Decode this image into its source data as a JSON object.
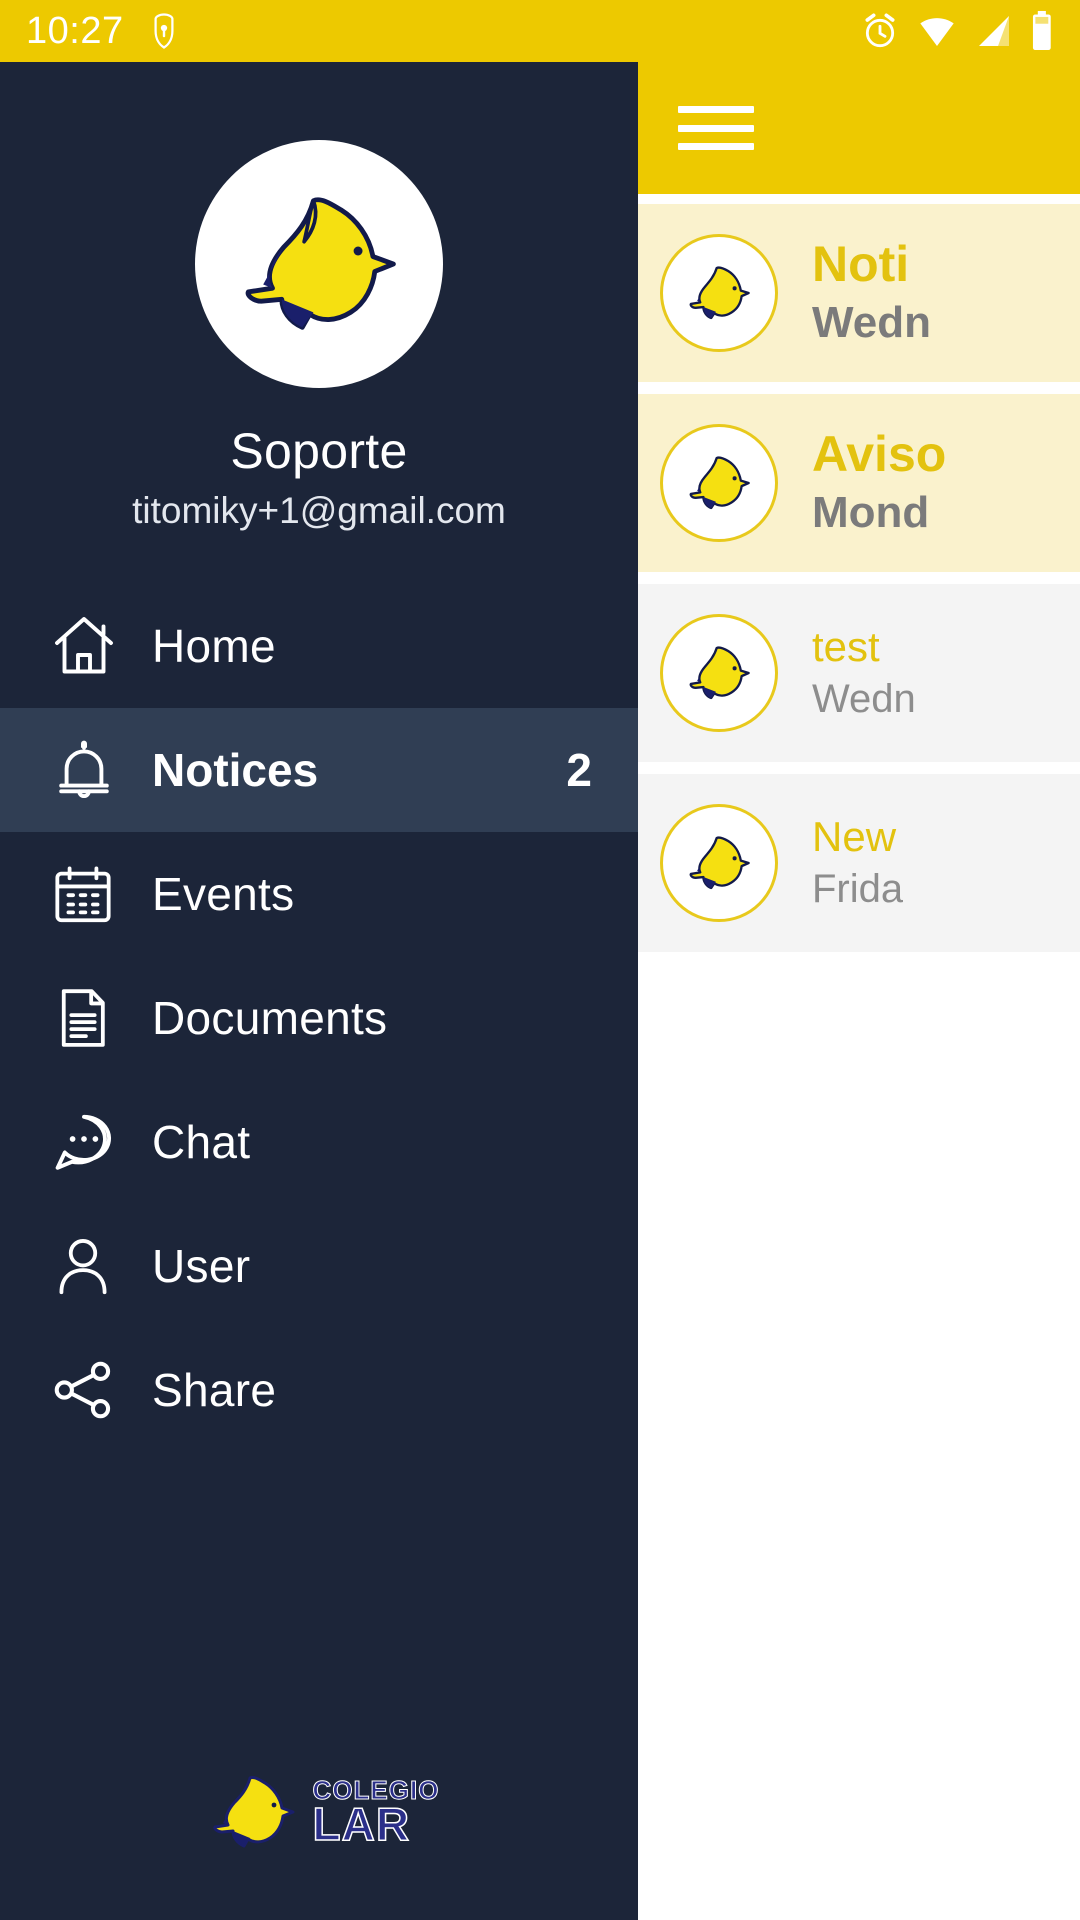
{
  "status_bar": {
    "time": "10:27",
    "icons": [
      "vpn-shield-icon",
      "alarm-icon",
      "wifi-icon",
      "signal-icon",
      "battery-icon"
    ],
    "background": "#edc900"
  },
  "app_bar": {
    "menu_icon": "hamburger-icon",
    "background": "#edc900"
  },
  "drawer": {
    "background": "#1c2539",
    "active_background": "#303e54",
    "profile": {
      "avatar_icon": "dove-logo-icon",
      "name": "Soporte",
      "email": "titomiky+1@gmail.com"
    },
    "items": [
      {
        "label": "Home",
        "icon": "home-icon",
        "badge": "",
        "active": false
      },
      {
        "label": "Notices",
        "icon": "bell-icon",
        "badge": "2",
        "active": true
      },
      {
        "label": "Events",
        "icon": "calendar-icon",
        "badge": "",
        "active": false
      },
      {
        "label": "Documents",
        "icon": "document-icon",
        "badge": "",
        "active": false
      },
      {
        "label": "Chat",
        "icon": "chat-icon",
        "badge": "",
        "active": false
      },
      {
        "label": "User",
        "icon": "user-icon",
        "badge": "",
        "active": false
      },
      {
        "label": "Share",
        "icon": "share-icon",
        "badge": "",
        "active": false
      }
    ],
    "footer": {
      "logo_icon": "dove-logo-icon",
      "brand_top": "COLEGIO",
      "brand_bottom": "LAR"
    }
  },
  "notice_list": {
    "unread_background": "#faf2cd",
    "read_background": "#f4f4f4",
    "title_color": "#e3c20f",
    "date_color": "#7b7b7b",
    "items": [
      {
        "avatar_icon": "dove-logo-icon",
        "title": "Noti",
        "date": "Wedn",
        "state": "unread",
        "title_size": "big"
      },
      {
        "avatar_icon": "dove-logo-icon",
        "title": "Aviso",
        "date": "Mond",
        "state": "unread",
        "title_size": "big"
      },
      {
        "avatar_icon": "dove-logo-icon",
        "title": "test",
        "date": "Wedn",
        "state": "read",
        "title_size": "small"
      },
      {
        "avatar_icon": "dove-logo-icon",
        "title": "New",
        "date": "Frida",
        "state": "read",
        "title_size": "small"
      }
    ]
  }
}
